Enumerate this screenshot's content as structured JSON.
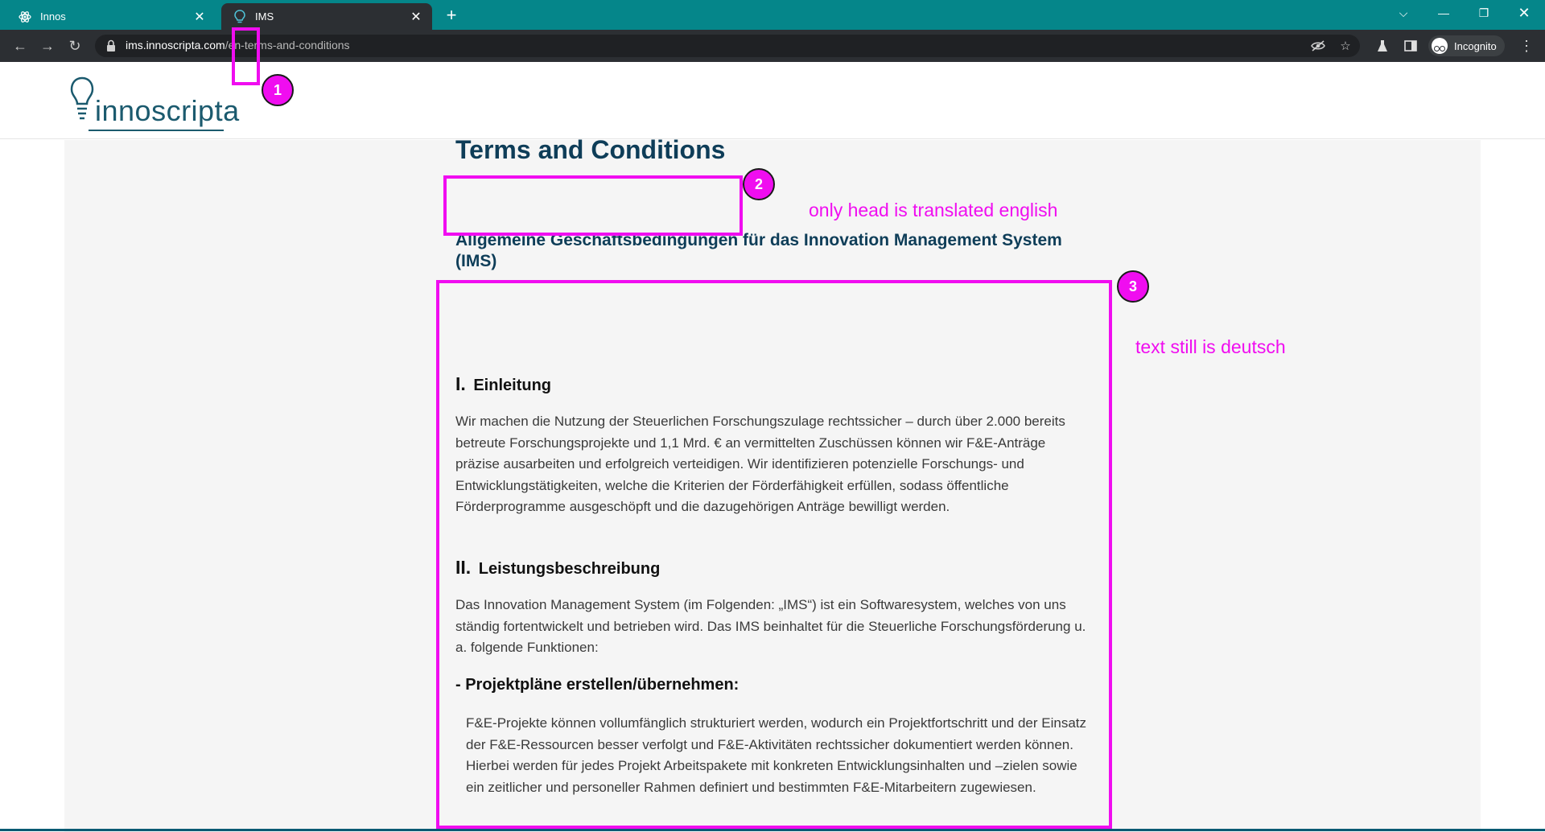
{
  "browser": {
    "tabs": [
      {
        "title": "Innos",
        "active": false,
        "icon": "atom-icon"
      },
      {
        "title": "IMS",
        "active": true,
        "icon": "lightbulb-icon"
      }
    ],
    "url_host": "ims.innoscripta.com",
    "url_path": "/en-terms-and-conditions",
    "incognito_label": "Incognito",
    "colors": {
      "tabbar": "#05868a",
      "toolbar": "#2c2f33"
    }
  },
  "site": {
    "logo_text": "innoscripta",
    "brand_color": "#1b5a6e"
  },
  "content": {
    "page_title": "Terms and Conditions",
    "main_title": "Allgemeine Geschäftsbedingungen für das Innovation Management System (IMS)",
    "sections": [
      {
        "num": "I.",
        "title": "Einleitung",
        "text": "Wir machen die Nutzung der Steuerlichen Forschungszulage rechtssicher – durch über 2.000 bereits betreute Forschungsprojekte und 1,1 Mrd. € an vermittelten Zuschüssen können wir F&E-Anträge präzise ausarbeiten und erfolgreich verteidigen. Wir identifizieren potenzielle Forschungs- und Entwicklungstätigkeiten, welche die Kriterien der Förderfähigkeit erfüllen, sodass öffentliche Förderprogramme ausgeschöpft und die dazugehörigen Anträge bewilligt werden."
      },
      {
        "num": "II.",
        "title": "Leistungsbeschreibung",
        "text": "Das Innovation Management System (im Folgenden: „IMS“) ist ein Softwaresystem, welches von uns ständig fortentwickelt und betrieben wird. Das IMS beinhaltet für die Steuerliche Forschungsförderung u. a. folgende Funktionen:"
      }
    ],
    "subsection": {
      "title": "- Projektpläne erstellen/übernehmen:",
      "text": "F&E-Projekte können vollumfänglich strukturiert werden, wodurch ein Projektfortschritt und der Einsatz der F&E-Ressourcen besser verfolgt und F&E-Aktivitäten rechtssicher dokumentiert werden können. Hierbei werden für jedes Projekt Arbeitspakete mit konkreten Entwicklungsinhalten und –zielen sowie ein zeitlicher und personeller Rahmen definiert und bestimmten F&E-Mitarbeitern zugewiesen."
    }
  },
  "annotations": {
    "color": "#f00df0",
    "badges": [
      "1",
      "2",
      "3"
    ],
    "notes": {
      "head": "only head is translated english",
      "text": "text still is deutsch"
    }
  }
}
